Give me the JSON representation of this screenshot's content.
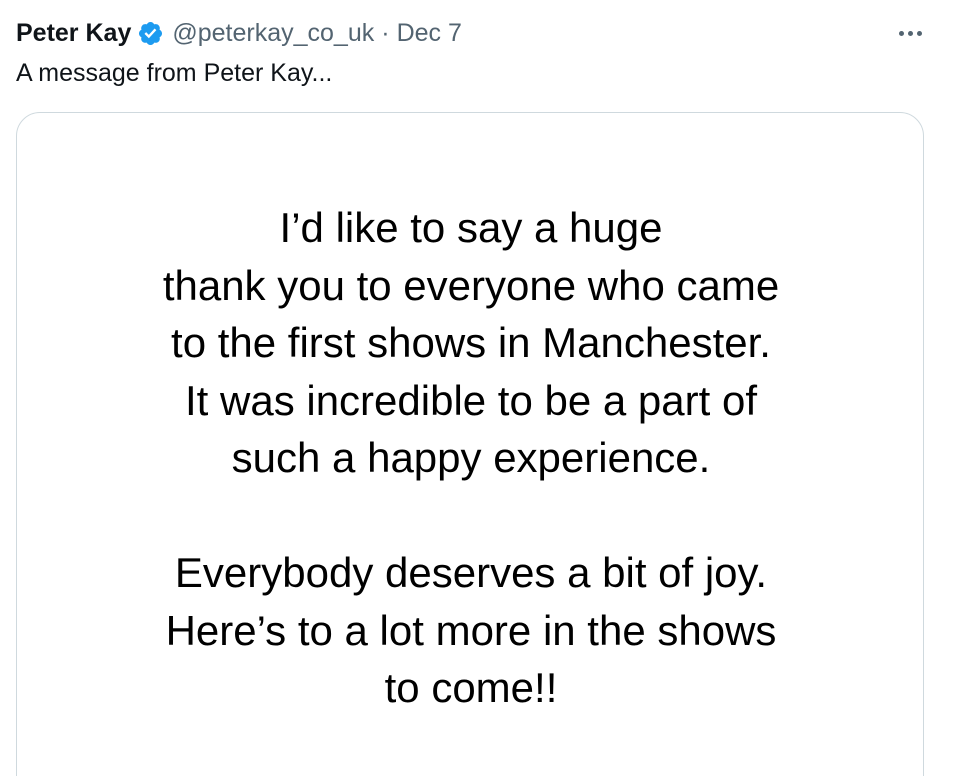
{
  "tweet": {
    "display_name": "Peter Kay",
    "verified_icon": "verified-badge-icon",
    "handle": "@peterkay_co_uk",
    "separator": "·",
    "date": "Dec 7",
    "more_icon": "more-options-icon",
    "text": "A message from Peter Kay..."
  },
  "media": {
    "paragraph1": [
      "I’d like to say a huge",
      "thank you to everyone who came",
      "to the first shows in Manchester.",
      "It was incredible to be a part of",
      "such a happy experience."
    ],
    "paragraph2": [
      "Everybody deserves a bit of joy.",
      "Here’s to a lot more in the shows",
      "to come!!"
    ]
  },
  "colors": {
    "verified_blue": "#1d9bf0",
    "secondary_text": "#536471",
    "primary_text": "#0f1419",
    "card_border": "#cfd9de"
  }
}
